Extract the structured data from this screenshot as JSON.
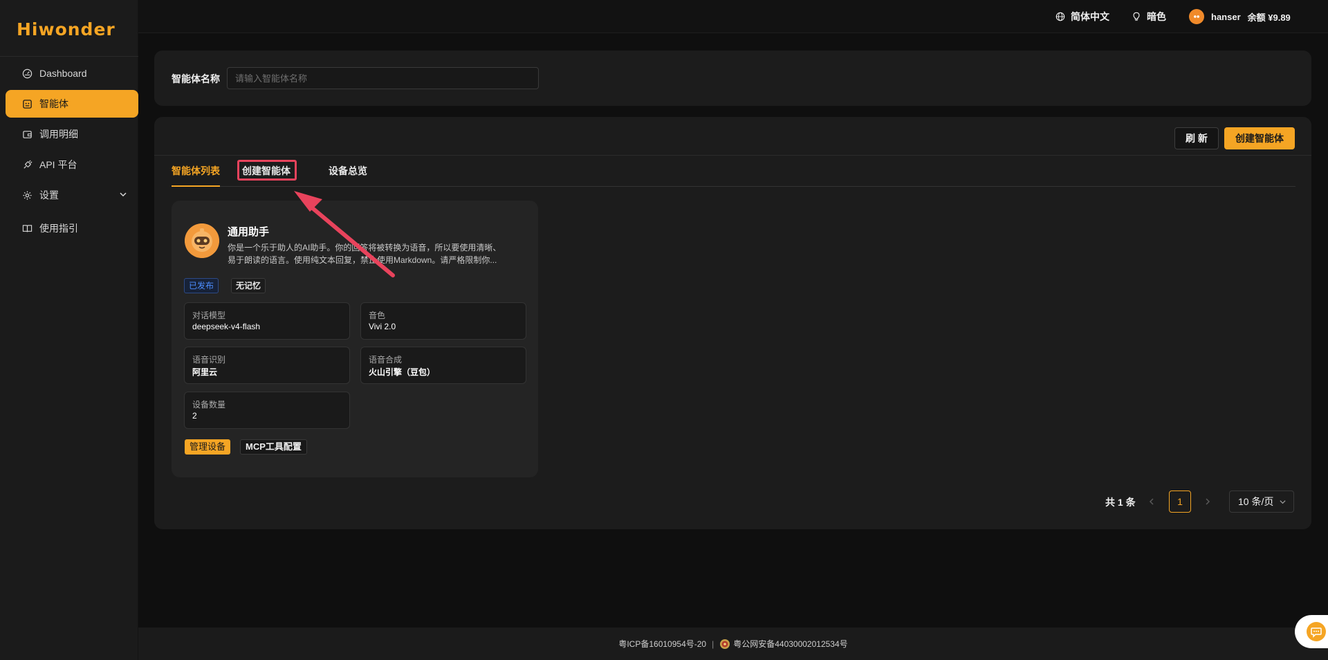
{
  "brand": {
    "logo_text": "Hiwonder",
    "accent": "#f5a524"
  },
  "header": {
    "language": "简体中文",
    "theme": "暗色",
    "username": "hanser",
    "balance": "余额 ¥9.89"
  },
  "sidebar": {
    "items": [
      {
        "label": "Dashboard",
        "icon": "dashboard-icon"
      },
      {
        "label": "智能体",
        "icon": "agent-icon",
        "active": true
      },
      {
        "label": "调用明细",
        "icon": "wallet-icon"
      },
      {
        "label": "API 平台",
        "icon": "plug-icon"
      },
      {
        "label": "设置",
        "icon": "gear-icon"
      },
      {
        "label": "使用指引",
        "icon": "book-icon"
      }
    ]
  },
  "search": {
    "label": "智能体名称",
    "placeholder": "请输入智能体名称",
    "value": ""
  },
  "toolbar": {
    "refresh_label": "刷 新",
    "create_label": "创建智能体"
  },
  "tabs": [
    {
      "label": "智能体列表",
      "active": true
    },
    {
      "label": "创建智能体",
      "highlighted": true
    },
    {
      "label": "设备总览"
    }
  ],
  "card": {
    "title": "通用助手",
    "description_line1": "你是一个乐于助人的AI助手。你的回答将被转换为语音，所以要使用清晰、",
    "description_line2": "易于朗读的语言。使用纯文本回复，禁止使用Markdown。请严格限制你...",
    "badges": {
      "published": "已发布",
      "memory": "无记忆"
    },
    "fields": {
      "model": {
        "label": "对话模型",
        "value": "deepseek-v4-flash"
      },
      "voice": {
        "label": "音色",
        "value": "Vivi 2.0"
      },
      "asr": {
        "label": "语音识别",
        "value": "阿里云"
      },
      "tts": {
        "label": "语音合成",
        "value": "火山引擎（豆包）"
      },
      "devices": {
        "label": "设备数量",
        "value": "2"
      }
    },
    "actions": {
      "manage": "管理设备",
      "mcp": "MCP工具配置"
    }
  },
  "pagination": {
    "total": "共 1 条",
    "current_page": "1",
    "page_size": "10 条/页"
  },
  "footer": {
    "icp": "粤ICP备16010954号-20",
    "separator": "|",
    "police": "粤公网安备44030002012534号"
  }
}
